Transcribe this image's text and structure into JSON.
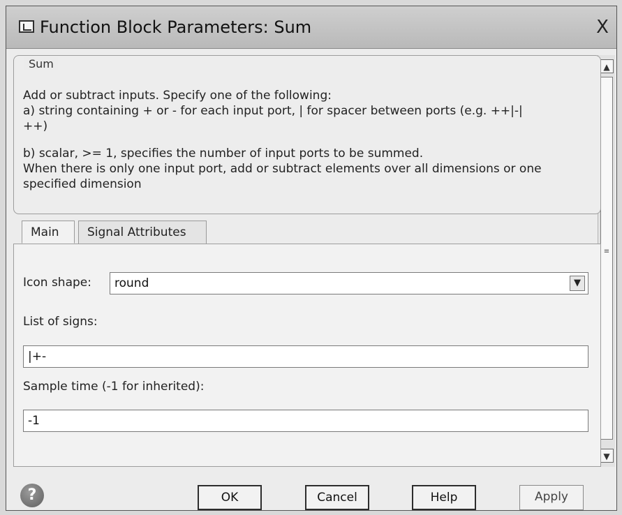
{
  "window": {
    "title": "Function Block Parameters: Sum",
    "close_label": "X"
  },
  "description": {
    "section_label": "Sum",
    "lines": [
      "Add or subtract inputs.  Specify one of the following:",
      "a) string containing + or - for each input port, | for spacer between ports (e.g. ++|-|",
      "++)",
      "b) scalar, >= 1, specifies the number of input ports to be summed.",
      "When there is only one input port, add or subtract elements over all dimensions or one",
      "specified dimension"
    ]
  },
  "tabs": [
    {
      "label": "Main"
    },
    {
      "label": "Signal Attributes"
    }
  ],
  "params": {
    "icon_shape_label": "Icon shape:",
    "icon_shape_value": "round",
    "list_of_signs_label": "List of signs:",
    "list_of_signs_value": "|+-",
    "sample_time_label": "Sample time (-1 for inherited):",
    "sample_time_value": "-1"
  },
  "buttons": {
    "ok": "OK",
    "cancel": "Cancel",
    "help": "Help",
    "apply": "Apply"
  },
  "icons": {
    "app": "block-icon",
    "close": "close-icon",
    "help": "question-circle-icon",
    "scroll_up": "chevron-up-icon",
    "scroll_down": "chevron-down-icon",
    "dropdown": "dropdown-arrow-icon"
  }
}
